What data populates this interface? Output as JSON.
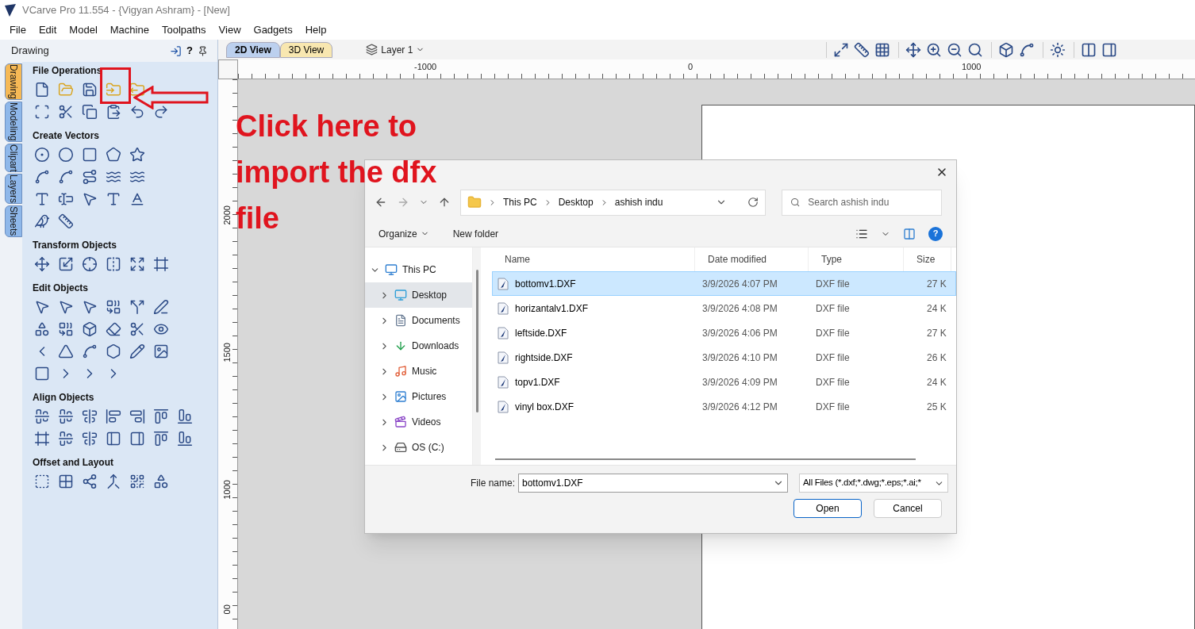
{
  "window": {
    "title": "VCarve Pro 11.554 - {Vigyan Ashram} - [New]"
  },
  "menu": [
    "File",
    "Edit",
    "Model",
    "Machine",
    "Toolpaths",
    "View",
    "Gadgets",
    "Help"
  ],
  "panel": {
    "title": "Drawing",
    "help": "?",
    "side_tabs": [
      {
        "label": "Drawing",
        "selected": true
      },
      {
        "label": "Modeling",
        "selected": false
      },
      {
        "label": "Clipart",
        "selected": false
      },
      {
        "label": "Layers",
        "selected": false
      },
      {
        "label": "Sheets",
        "selected": false
      }
    ],
    "sections": [
      {
        "title": "File Operations"
      },
      {
        "title": "Create Vectors"
      },
      {
        "title": "Transform Objects"
      },
      {
        "title": "Edit Objects"
      },
      {
        "title": "Align Objects"
      },
      {
        "title": "Offset and Layout"
      }
    ]
  },
  "view_tabs": [
    {
      "label": "2D View",
      "selected": true
    },
    {
      "label": "3D View",
      "selected": false
    }
  ],
  "layer": {
    "label": "Layer 1"
  },
  "rulers": {
    "horizontal": [
      "-1000",
      "0",
      "1000"
    ],
    "vertical": [
      "2000",
      "1500",
      "1000",
      "00"
    ]
  },
  "annotation": {
    "lines": [
      "Click here to",
      "import the dfx",
      "file"
    ]
  },
  "dialog": {
    "path": [
      "This PC",
      "Desktop",
      "ashish indu"
    ],
    "search": {
      "placeholder": "Search ashish indu"
    },
    "organize": "Organize",
    "new_folder": "New folder",
    "help": "?",
    "nav": [
      {
        "label": "This PC",
        "expanded": true,
        "selected": false,
        "children": [
          {
            "label": "Desktop",
            "expanded": false,
            "selected": true
          },
          {
            "label": "Documents",
            "expanded": false,
            "selected": false
          },
          {
            "label": "Downloads",
            "expanded": false,
            "selected": false
          },
          {
            "label": "Music",
            "expanded": false,
            "selected": false
          },
          {
            "label": "Pictures",
            "expanded": false,
            "selected": false
          },
          {
            "label": "Videos",
            "expanded": false,
            "selected": false
          },
          {
            "label": "OS (C:)",
            "expanded": false,
            "selected": false
          }
        ]
      }
    ],
    "columns": [
      "Name",
      "Date modified",
      "Type",
      "Size"
    ],
    "files": [
      {
        "name": "bottomv1.DXF",
        "date": "3/9/2026 4:07 PM",
        "type": "DXF file",
        "size": "27 K",
        "selected": true
      },
      {
        "name": "horizantalv1.DXF",
        "date": "3/9/2026 4:08 PM",
        "type": "DXF file",
        "size": "24 K",
        "selected": false
      },
      {
        "name": "leftside.DXF",
        "date": "3/9/2026 4:06 PM",
        "type": "DXF file",
        "size": "27 K",
        "selected": false
      },
      {
        "name": "rightside.DXF",
        "date": "3/9/2026 4:10 PM",
        "type": "DXF file",
        "size": "26 K",
        "selected": false
      },
      {
        "name": "topv1.DXF",
        "date": "3/9/2026 4:09 PM",
        "type": "DXF file",
        "size": "24 K",
        "selected": false
      },
      {
        "name": "vinyl box.DXF",
        "date": "3/9/2026 4:12 PM",
        "type": "DXF file",
        "size": "25 K",
        "selected": false
      }
    ],
    "file_name_label": "File name:",
    "file_name": "bottomv1.DXF",
    "filter": "All Files (*.dxf;*.dwg;*.eps;*.ai;*",
    "buttons": [
      "Open",
      "Cancel"
    ]
  }
}
